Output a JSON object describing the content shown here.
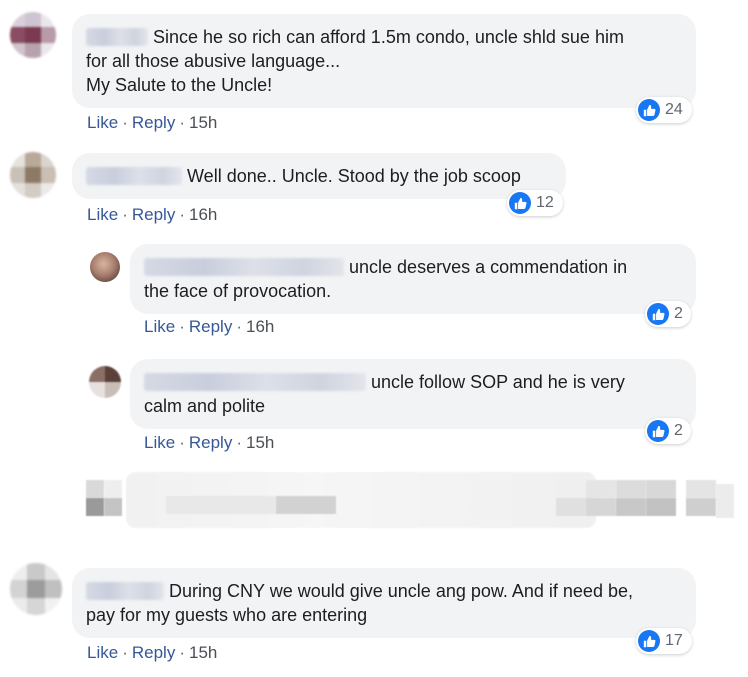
{
  "comments": [
    {
      "text_1": "Since he so rich can afford 1.5m condo, uncle shld sue him",
      "text_2": "for all those abusive language...",
      "text_3": "My Salute to the Uncle!",
      "like": "Like",
      "reply": "Reply",
      "time": "15h",
      "reactions": "24"
    },
    {
      "text_1": "Well done.. Uncle. Stood by the job scoop",
      "like": "Like",
      "reply": "Reply",
      "time": "16h",
      "reactions": "12"
    },
    {
      "text_1": "uncle deserves a commendation in",
      "text_2": "the face of provocation.",
      "like": "Like",
      "reply": "Reply",
      "time": "16h",
      "reactions": "2"
    },
    {
      "text_1": "uncle follow SOP and he is very",
      "text_2": "calm and polite",
      "like": "Like",
      "reply": "Reply",
      "time": "15h",
      "reactions": "2"
    },
    {
      "text_1": "During CNY we would give uncle ang pow. And if need be,",
      "text_2": "pay for my guests who are entering",
      "like": "Like",
      "reply": "Reply",
      "time": "15h",
      "reactions": "17"
    }
  ],
  "separator": "·",
  "colors": {
    "bubble": "#f2f3f5",
    "link": "#365899",
    "like_blue": "#1877f2",
    "text": "#1c1e21"
  }
}
